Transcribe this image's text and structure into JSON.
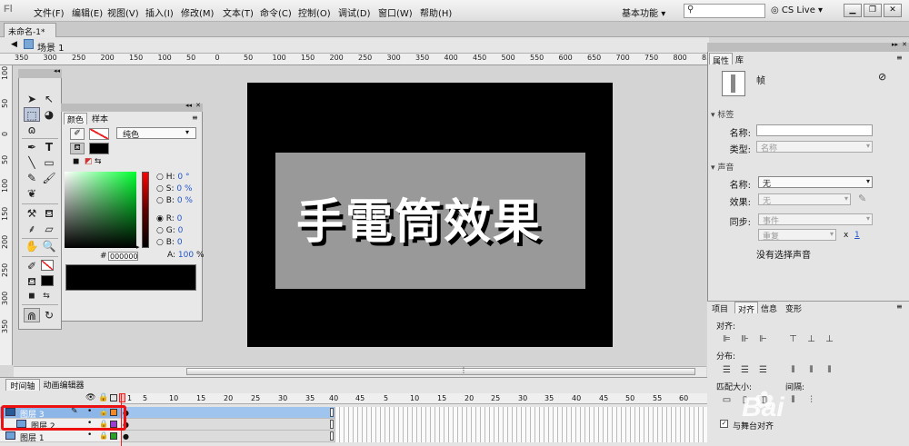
{
  "menubar": {
    "logo": "Fl",
    "items": [
      "文件(F)",
      "编辑(E)",
      "视图(V)",
      "插入(I)",
      "修改(M)",
      "文本(T)",
      "命令(C)",
      "控制(O)",
      "调试(D)",
      "窗口(W)",
      "帮助(H)"
    ],
    "workspace": "基本功能",
    "search_placeholder": "",
    "cs_live": "CS Live"
  },
  "document": {
    "tab": "未命名-1*",
    "scene": "场景 1"
  },
  "ruler": {
    "top_labels": [
      "350",
      "300",
      "250",
      "200",
      "150",
      "100",
      "50",
      "0",
      "50",
      "100",
      "150",
      "200",
      "250",
      "300",
      "350",
      "400",
      "450",
      "500",
      "550",
      "600",
      "650",
      "700",
      "750",
      "800",
      "850"
    ],
    "left_labels": [
      "100",
      "50",
      "0",
      "50",
      "100",
      "150",
      "200",
      "250",
      "300",
      "350"
    ]
  },
  "stage": {
    "text": "手電筒效果",
    "background": "#000000",
    "rect_color": "#999999",
    "text_color": "#ffffff"
  },
  "color_panel": {
    "tab_color": "颜色",
    "tab_swatches": "样本",
    "fill_type": "纯色",
    "h_label": "H:",
    "h_value": "0 °",
    "s_label": "S:",
    "s_value": "0 %",
    "b_label": "B:",
    "b_value": "0 %",
    "r_label": "R:",
    "r_value": "0",
    "g_label": "G:",
    "g_value": "0",
    "bb_label": "B:",
    "bb_value": "0",
    "hex_label": "#",
    "hex_value": "000000",
    "alpha_label": "A:",
    "alpha_value": "100",
    "alpha_unit": "%"
  },
  "properties": {
    "tab_properties": "属性",
    "tab_library": "库",
    "frame_label": "帧",
    "section_label": "标签",
    "name_label": "名称:",
    "type_label": "类型:",
    "type_value": "名称",
    "section_sound": "声音",
    "sound_name_label": "名称:",
    "sound_name_value": "无",
    "effect_label": "效果:",
    "effect_value": "无",
    "sync_label": "同步:",
    "sync_value": "事件",
    "repeat_value": "重复",
    "repeat_x": "x",
    "repeat_count": "1",
    "no_sound": "没有选择声音"
  },
  "align_panel": {
    "tabs": [
      "项目",
      "对齐",
      "信息",
      "变形"
    ],
    "align_label": "对齐:",
    "distribute_label": "分布:",
    "match_label": "匹配大小:",
    "spacing_label": "间隔:",
    "stage_label": "与舞台对齐"
  },
  "timeline": {
    "tab_timeline": "时间轴",
    "tab_motion": "动画编辑器",
    "frame_numbers": [
      "1",
      "5",
      "10",
      "15",
      "20",
      "25",
      "30",
      "35",
      "40",
      "45",
      "5",
      "10",
      "15",
      "20",
      "25",
      "30",
      "35",
      "40",
      "45",
      "50",
      "55",
      "60",
      "65",
      "70"
    ],
    "layers": [
      {
        "name": "图层 3",
        "selected": true,
        "color": "#f08a28"
      },
      {
        "name": "图层 2",
        "selected": false,
        "color": "#9a3fd0"
      },
      {
        "name": "图层 1",
        "selected": false,
        "color": "#2aa02a"
      }
    ]
  },
  "watermark": "Bai"
}
